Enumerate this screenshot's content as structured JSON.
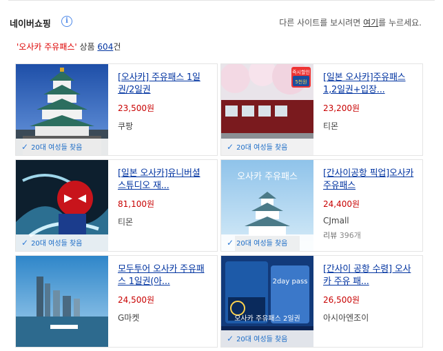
{
  "header": {
    "title": "네이버쇼핑",
    "info_icon_glyph": "i",
    "guide_prefix": "다른 사이트를 보시려면 ",
    "guide_link": "여기",
    "guide_suffix": "를 누르세요."
  },
  "subhead": {
    "keyword": "'오사카 주유패스'",
    "label": " 상품 ",
    "count": "604",
    "unit": "건"
  },
  "products": [
    {
      "title_pre": "[",
      "title_bold": "오사카",
      "title_post": "] 주유패스 1일권/2일권",
      "title_display": "[오사카] 주유패스 1일권/2일권",
      "price": "23,500원",
      "store": "쿠팡",
      "badge": "20대 여성들 찾음",
      "image": "osaka-castle-photo"
    },
    {
      "title_display": "[일본 오사카]주유패스1,2일권+입장...",
      "price": "23,200원",
      "store": "티몬",
      "badge": "20대 여성들 찾음",
      "image": "train-cherry-blossom-photo",
      "promo_top": "즉시할인",
      "promo_bottom": "5천원"
    },
    {
      "title_display": "[일본 오사카]유니버셜 스튜디오 재...",
      "price": "81,100원",
      "store": "티몬",
      "badge": "20대 여성들 찾음",
      "image": "spiderman-photo"
    },
    {
      "title_display": "[간사이공항 픽업]오사카주유패스",
      "price": "24,400원",
      "store": "CJmall",
      "review_label": "리뷰",
      "review_count": "396개",
      "badge": "20대 여성들 찾음",
      "image": "osaka-castle-pass-photo",
      "overlay_text": "오사카 주유패스"
    },
    {
      "title_display": "모두투어 오사카 주유패스 1일권(아...",
      "price": "24,500원",
      "store": "G마켓",
      "badge": "",
      "image": "osaka-skyline-photo"
    },
    {
      "title_display": "[간사이 공항 수령] 오사카 주유 패...",
      "price": "26,500원",
      "store": "아시아엔조이",
      "badge": "20대 여성들 찾음",
      "image": "amazing-pass-card-photo",
      "overlay_text": "오사카 주유패스 2일권",
      "card_text": "2day pass"
    }
  ],
  "colors": {
    "link": "#0033a0",
    "price": "#c80000",
    "badge": "#1a6bc6",
    "keyword": "#dd0000"
  }
}
